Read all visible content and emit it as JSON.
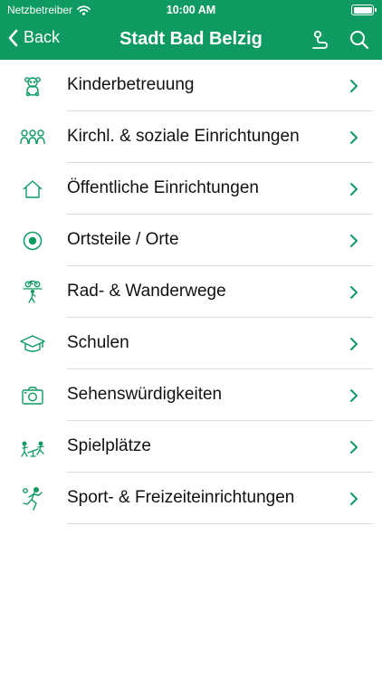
{
  "status_bar": {
    "carrier": "Netzbetreiber",
    "time": "10:00 AM"
  },
  "header": {
    "back_label": "Back",
    "title": "Stadt Bad Belzig",
    "actions": [
      "route-icon",
      "search-icon"
    ]
  },
  "theme": {
    "accent": "#0f9a62",
    "text": "#111111",
    "separator": "#dcdcdc"
  },
  "categories": [
    {
      "label": "Kinderbetreuung",
      "icon": "teddy-bear-icon"
    },
    {
      "label": "Kirchl. & soziale Einrichtungen",
      "icon": "people-group-icon"
    },
    {
      "label": "Öffentliche Einrichtungen",
      "icon": "house-icon"
    },
    {
      "label": "Ortsteile / Orte",
      "icon": "target-circle-icon"
    },
    {
      "label": "Rad- & Wanderwege",
      "icon": "bike-hike-icon"
    },
    {
      "label": "Schulen",
      "icon": "graduation-cap-icon"
    },
    {
      "label": "Sehenswürdigkeiten",
      "icon": "camera-icon"
    },
    {
      "label": "Spielplätze",
      "icon": "playground-icon"
    },
    {
      "label": "Sport- & Freizeiteinrichtungen",
      "icon": "sport-icon"
    }
  ]
}
